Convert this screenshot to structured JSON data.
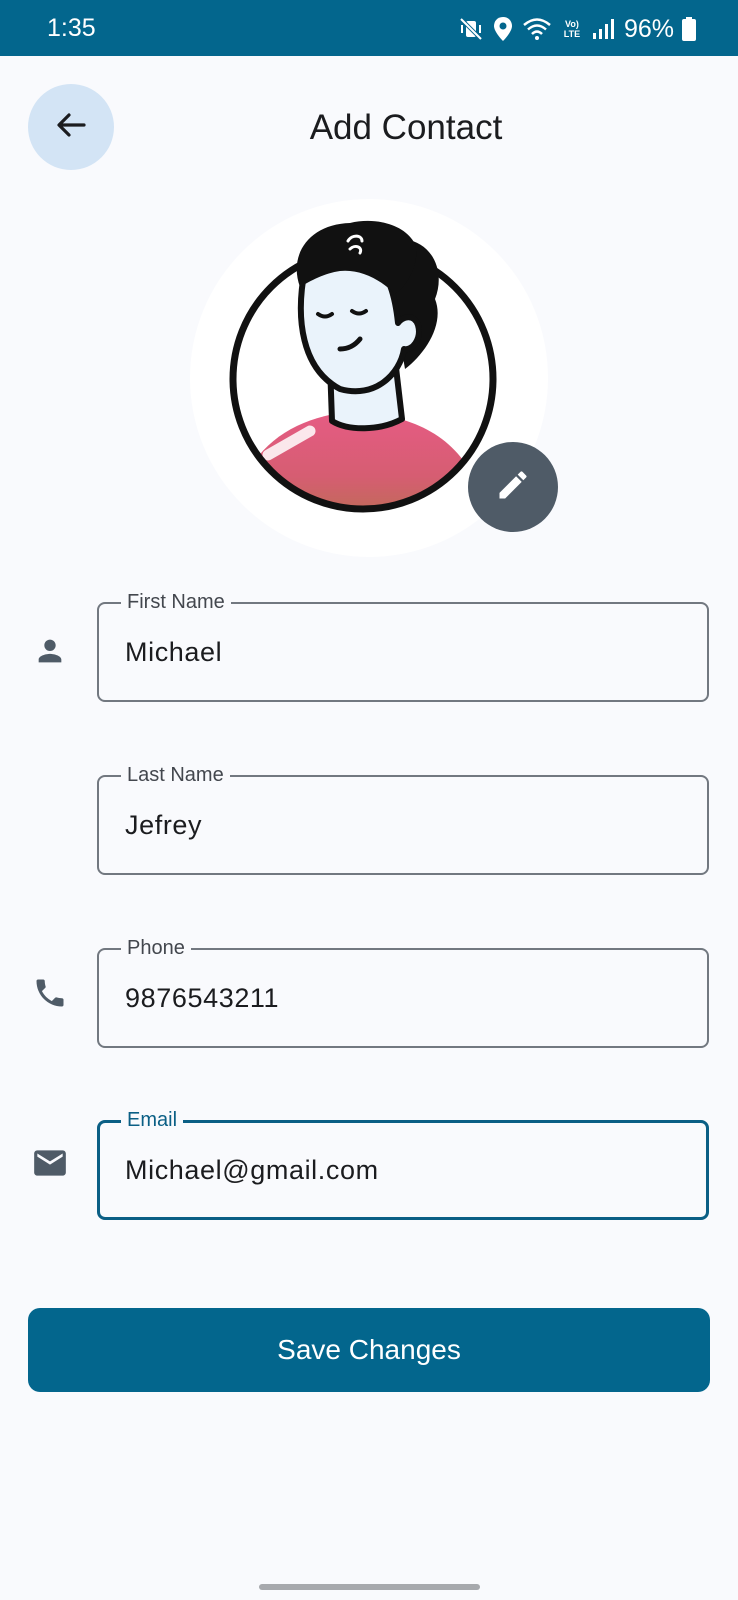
{
  "status_bar": {
    "time": "1:35",
    "volte_top": "Vo)",
    "volte_bottom": "LTE",
    "battery": "96%",
    "icons": [
      "mute-vibrate-icon",
      "location-icon",
      "wifi-icon",
      "volte-icon",
      "signal-icon",
      "battery-icon"
    ]
  },
  "header": {
    "back_icon": "arrow-left-icon",
    "title": "Add Contact"
  },
  "avatar": {
    "edit_icon": "pencil-icon"
  },
  "form": {
    "first_name": {
      "label": "First Name",
      "value": "Michael",
      "icon": "person-icon"
    },
    "last_name": {
      "label": "Last Name",
      "value": "Jefrey"
    },
    "phone": {
      "label": "Phone",
      "value": "9876543211",
      "icon": "phone-icon"
    },
    "email": {
      "label": "Email",
      "value": "Michael@gmail.com",
      "icon": "mail-icon",
      "focused": true
    }
  },
  "actions": {
    "save_label": "Save Changes"
  },
  "colors": {
    "primary": "#03668d",
    "background": "#f9fafd",
    "back_button_bg": "#d3e4f5",
    "edit_button_bg": "#4f5b67",
    "icon": "#4f5b67"
  }
}
